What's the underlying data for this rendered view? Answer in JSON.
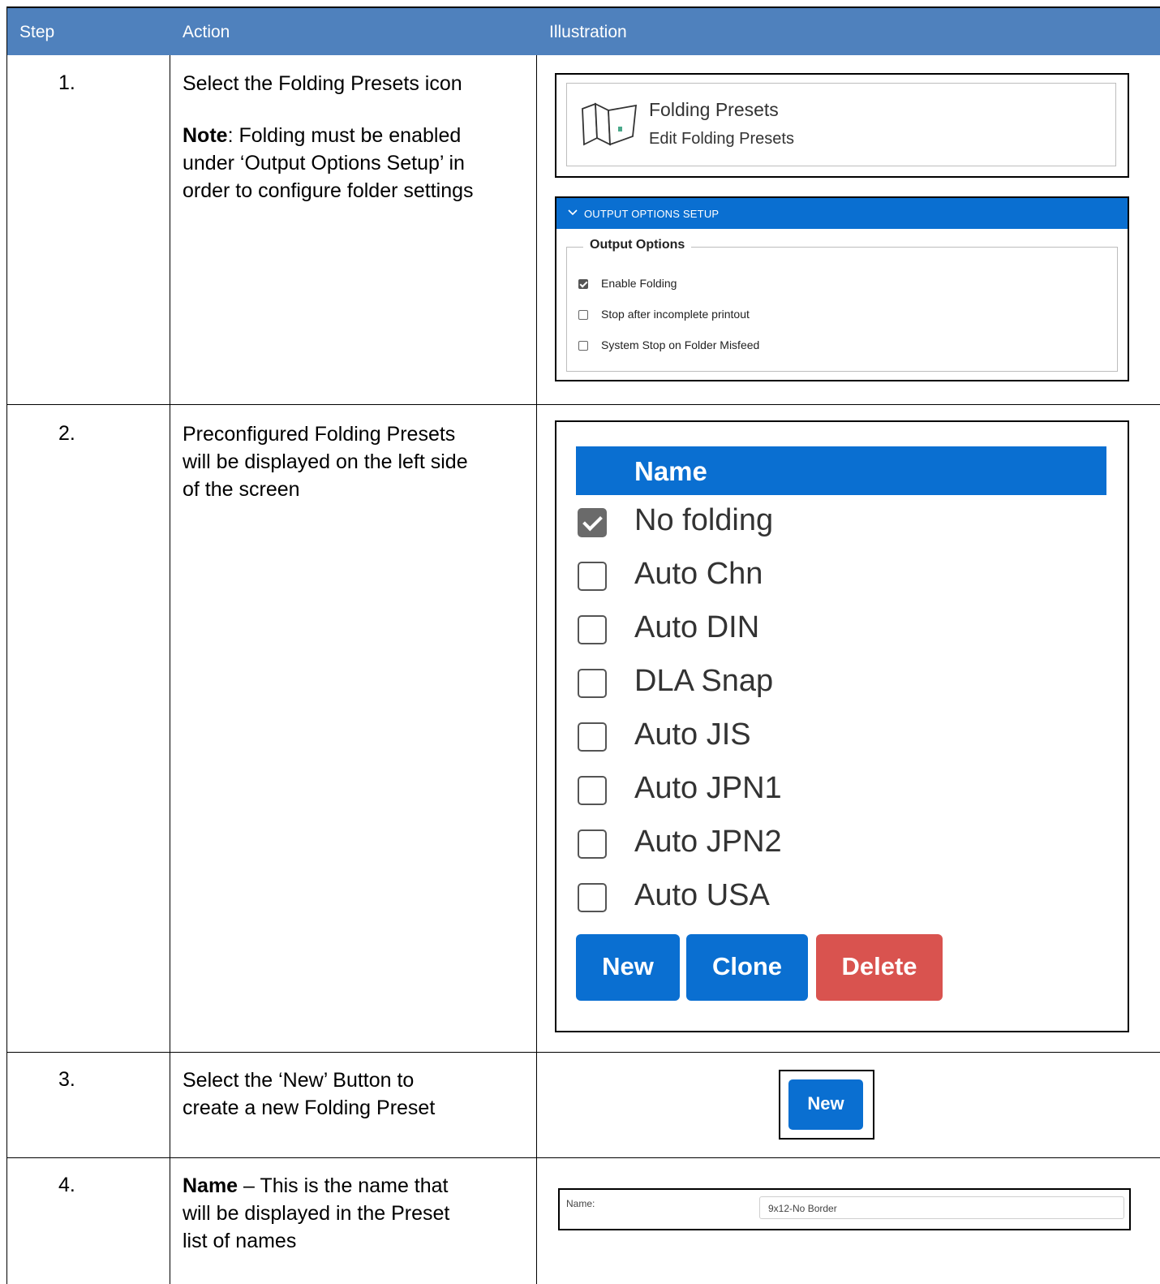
{
  "header": {
    "step": "Step",
    "action": "Action",
    "illustration": "Illustration"
  },
  "rows": [
    {
      "step": "1.",
      "action": "Select the Folding Presets icon",
      "note_label": "Note",
      "note_lines": [
        ": Folding must be enabled",
        "under ‘Output Options Setup’ in",
        "order to configure folder settings"
      ],
      "illus": {
        "folding_presets": {
          "title": "Folding Presets",
          "subtitle": "Edit Folding Presets",
          "icon": "folding-presets-icon"
        },
        "output_options": {
          "bar_title": "OUTPUT OPTIONS SETUP",
          "legend": "Output Options",
          "options": [
            {
              "label": "Enable Folding",
              "checked": true
            },
            {
              "label": "Stop after incomplete printout",
              "checked": false
            },
            {
              "label": "System Stop on Folder Misfeed",
              "checked": false
            }
          ]
        }
      }
    },
    {
      "step": "2.",
      "action_lines": [
        "Preconfigured Folding Presets",
        "will be displayed on the left side",
        "of the screen"
      ],
      "illus": {
        "column_header": "Name",
        "presets": [
          {
            "label": "No folding",
            "checked": true
          },
          {
            "label": "Auto Chn",
            "checked": false
          },
          {
            "label": "Auto DIN",
            "checked": false
          },
          {
            "label": "DLA Snap",
            "checked": false
          },
          {
            "label": "Auto JIS",
            "checked": false
          },
          {
            "label": "Auto JPN1",
            "checked": false
          },
          {
            "label": "Auto JPN2",
            "checked": false
          },
          {
            "label": "Auto USA",
            "checked": false
          }
        ],
        "buttons": {
          "new": "New",
          "clone": "Clone",
          "delete": "Delete"
        },
        "colors": {
          "primary": "#0a6fd1",
          "danger": "#d9534f"
        }
      }
    },
    {
      "step": "3.",
      "action_lines": [
        "Select the ‘New’ Button to",
        "create a new Folding Preset"
      ],
      "illus": {
        "button": "New"
      }
    },
    {
      "step": "4.",
      "name_label": "Name",
      "action_rest": [
        " – This is the name that",
        "will be displayed in the Preset",
        "list of names"
      ],
      "illus": {
        "field_label": "Name:",
        "field_value": "9x12-No Border"
      }
    }
  ],
  "colors": {
    "header_bg": "#4f81bd",
    "header_text": "#ffffff"
  }
}
